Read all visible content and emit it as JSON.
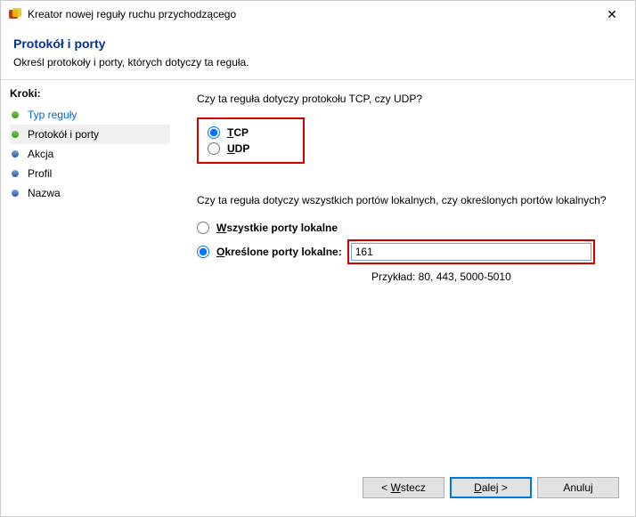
{
  "window": {
    "title": "Kreator nowej reguły ruchu przychodzącego"
  },
  "header": {
    "title": "Protokół i porty",
    "subtitle": "Określ protokoły i porty, których dotyczy ta reguła."
  },
  "sidebar": {
    "title": "Kroki:",
    "steps": [
      {
        "label": "Typ reguły",
        "state": "done",
        "link": true
      },
      {
        "label": "Protokół i porty",
        "state": "done",
        "current": true
      },
      {
        "label": "Akcja",
        "state": "pending"
      },
      {
        "label": "Profil",
        "state": "pending"
      },
      {
        "label": "Nazwa",
        "state": "pending"
      }
    ]
  },
  "content": {
    "q1": "Czy ta reguła dotyczy protokołu TCP, czy UDP?",
    "proto": {
      "tcp": "TCP",
      "udp": "UDP",
      "selected": "tcp"
    },
    "q2": "Czy ta reguła dotyczy wszystkich portów lokalnych, czy określonych portów lokalnych?",
    "ports": {
      "all_label": "Wszystkie porty lokalne",
      "specific_label": "Określone porty lokalne:",
      "selected": "specific",
      "value": "161",
      "example": "Przykład: 80, 443, 5000-5010"
    }
  },
  "buttons": {
    "back": "Wstecz",
    "next": "Dalej >",
    "cancel": "Anuluj"
  }
}
